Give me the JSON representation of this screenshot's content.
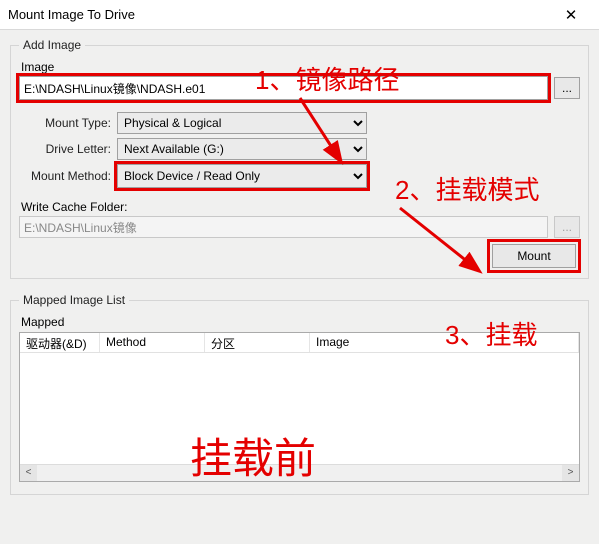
{
  "window": {
    "title": "Mount Image To Drive"
  },
  "addImage": {
    "legend": "Add Image",
    "imageLabel": "Image",
    "imagePath": "E:\\NDASH\\Linux镜像\\NDASH.e01",
    "browse": "...",
    "mountTypeLabel": "Mount Type:",
    "mountType": "Physical & Logical",
    "driveLetterLabel": "Drive Letter:",
    "driveLetter": "Next Available (G:)",
    "mountMethodLabel": "Mount Method:",
    "mountMethod": "Block Device / Read Only",
    "writeCacheLabel": "Write Cache Folder:",
    "writeCache": "E:\\NDASH\\Linux镜像",
    "browse2": "...",
    "mountButton": "Mount"
  },
  "mapped": {
    "legend": "Mapped Image List",
    "tableLegend": "Mapped",
    "cols": {
      "drive": "驱动器(&D)",
      "method": "Method",
      "partition": "分区",
      "image": "Image"
    }
  },
  "annotations": {
    "a1": "1、镜像路径",
    "a2": "2、挂载模式",
    "a3": "3、挂载",
    "center": "挂载前"
  }
}
